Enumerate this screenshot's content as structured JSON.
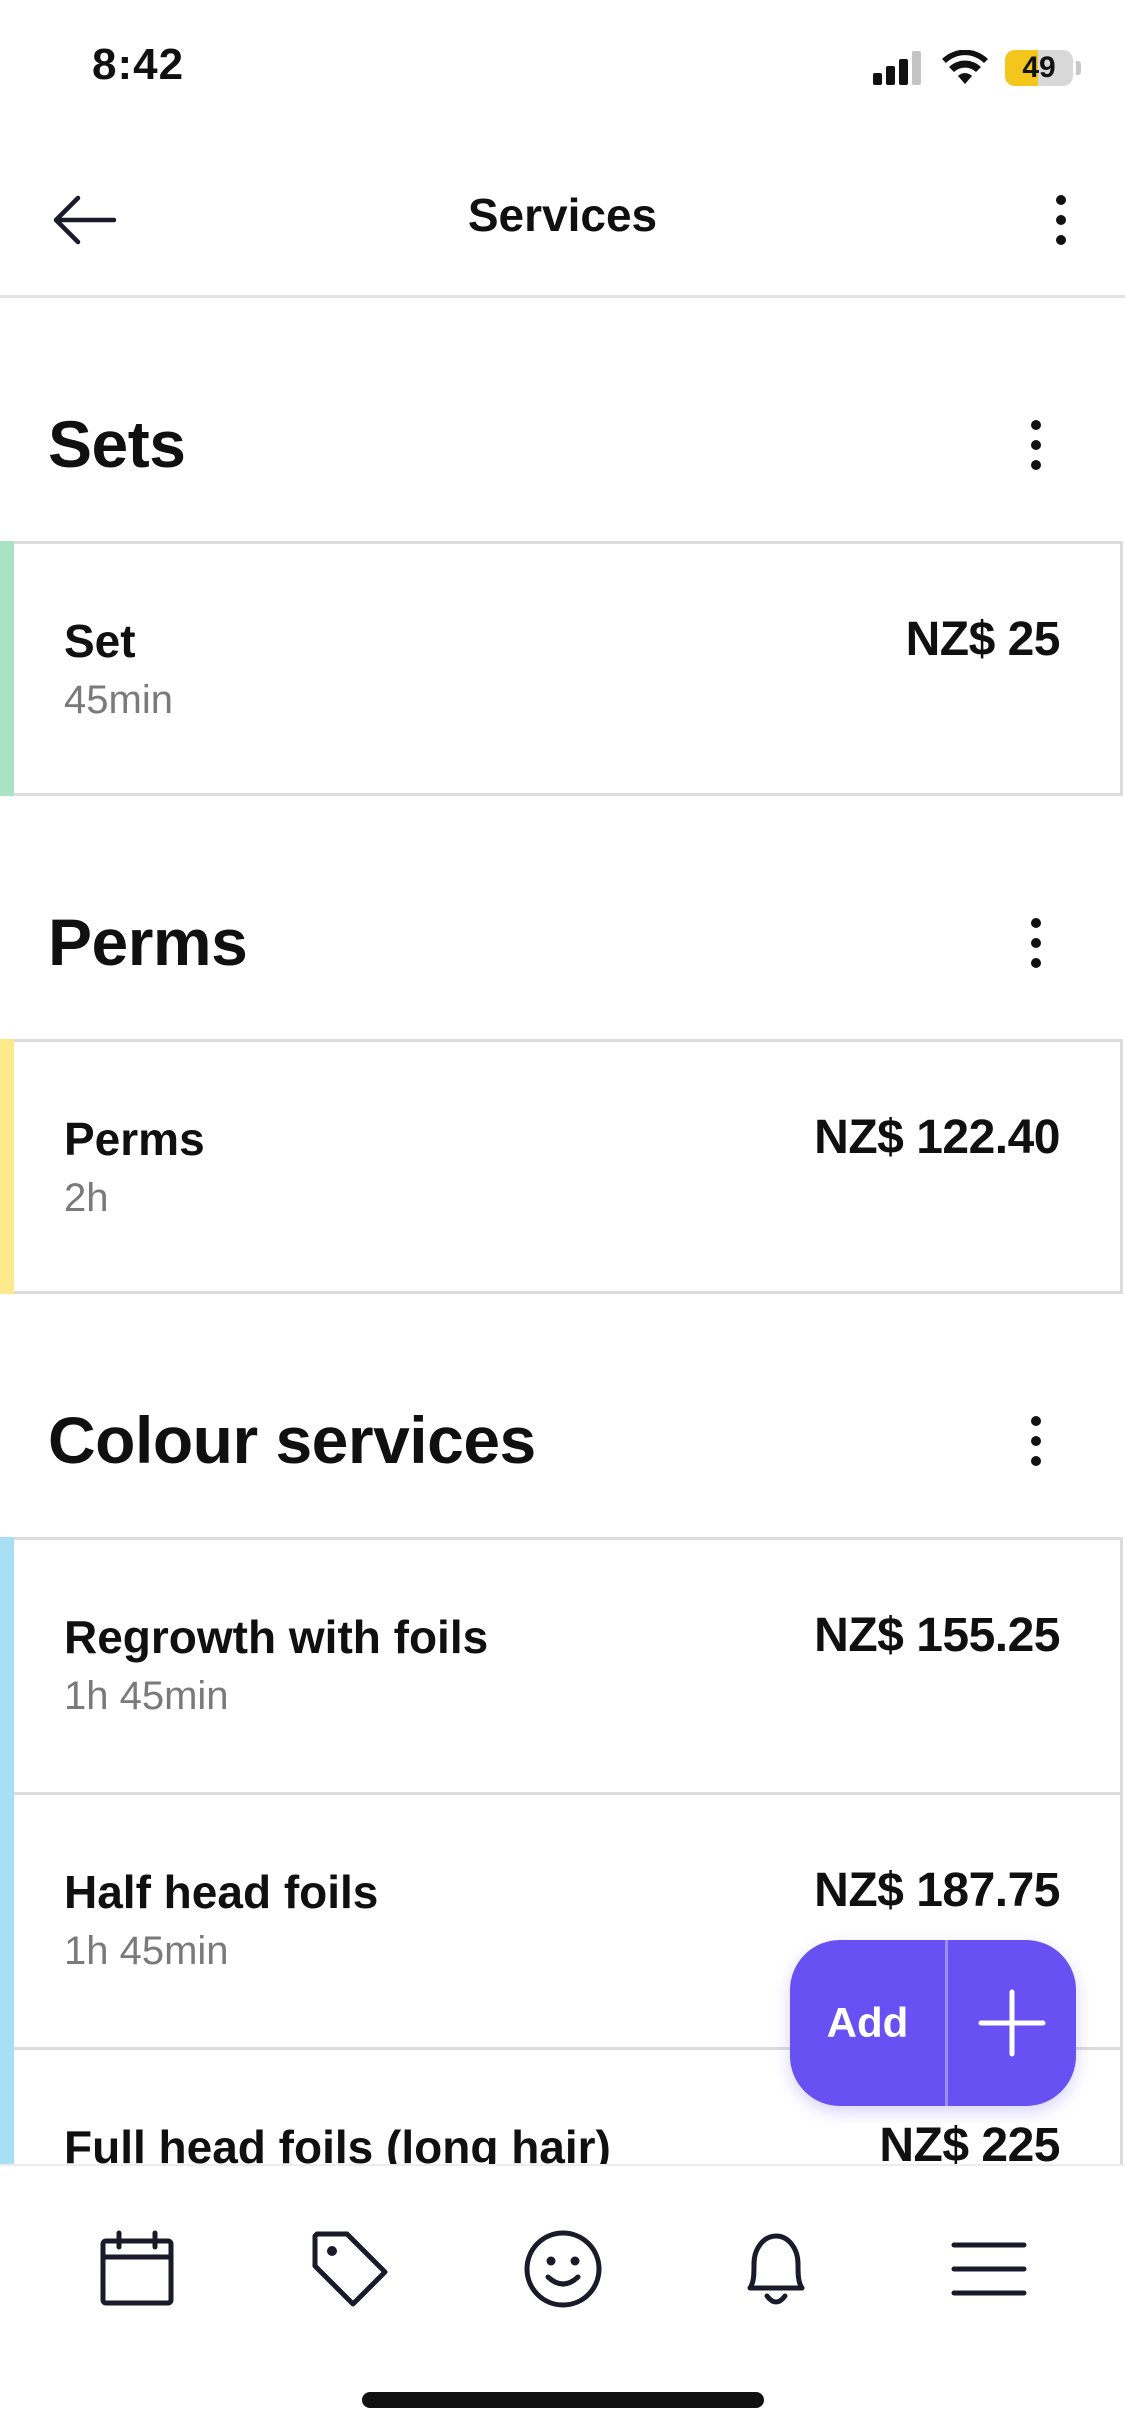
{
  "status_bar": {
    "time": "8:42",
    "battery_level": "49",
    "battery_fraction": 0.49,
    "icons": [
      "signal-icon",
      "wifi-icon",
      "battery-icon"
    ]
  },
  "header": {
    "title": "Services",
    "back_icon": "arrow-left-icon",
    "more_icon": "kebab-icon"
  },
  "categories": [
    {
      "title": "Sets",
      "accent": "#a8e3c4",
      "services": [
        {
          "name": "Set",
          "duration": "45min",
          "price": "NZ$ 25"
        }
      ]
    },
    {
      "title": "Perms",
      "accent": "#fbe98a",
      "services": [
        {
          "name": "Perms",
          "duration": "2h",
          "price": "NZ$ 122.40"
        }
      ]
    },
    {
      "title": "Colour services",
      "accent": "#a9dff4",
      "services": [
        {
          "name": "Regrowth with foils",
          "duration": "1h 45min",
          "price": "NZ$ 155.25"
        },
        {
          "name": "Half head foils",
          "duration": "1h 45min",
          "price": "NZ$ 187.75"
        },
        {
          "name": "Full head foils (long hair)",
          "duration": "",
          "price": "NZ$ 225"
        }
      ]
    }
  ],
  "fab": {
    "label": "Add",
    "icon": "plus-icon",
    "color": "#6950f3"
  },
  "bottom_nav": {
    "items": [
      {
        "name": "calendar",
        "icon": "calendar-icon"
      },
      {
        "name": "sales",
        "icon": "tag-icon"
      },
      {
        "name": "clients",
        "icon": "smiley-icon"
      },
      {
        "name": "notifications",
        "icon": "bell-icon"
      },
      {
        "name": "menu",
        "icon": "menu-icon"
      }
    ]
  }
}
